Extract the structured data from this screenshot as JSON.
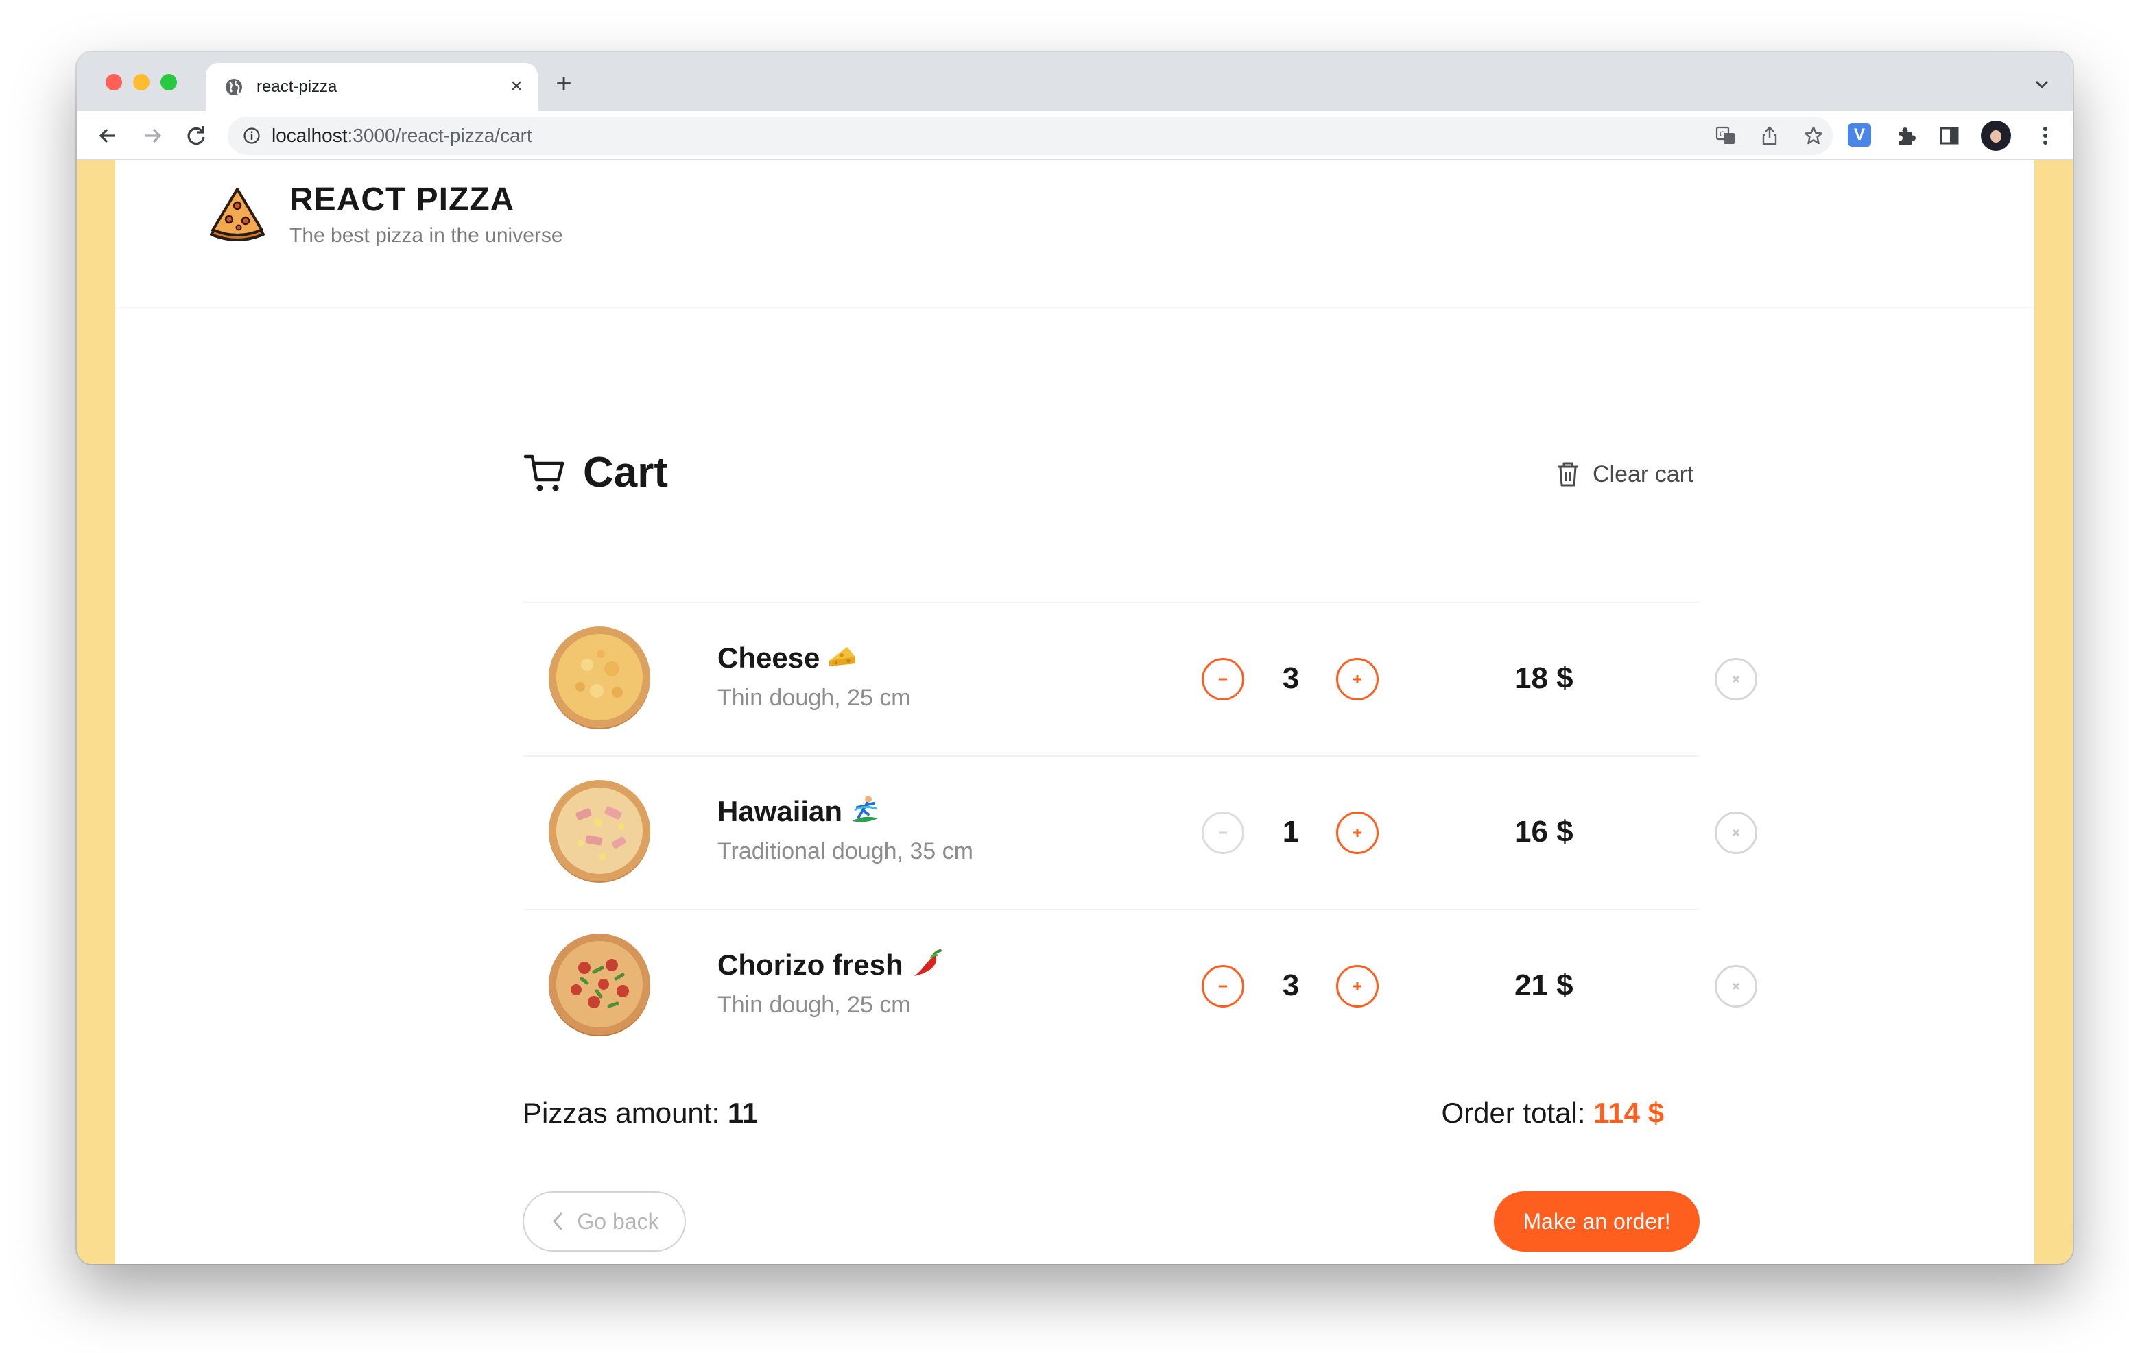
{
  "browser": {
    "tab_title": "react-pizza",
    "url_host": "localhost",
    "url_path": ":3000/react-pizza/cart"
  },
  "header": {
    "title": "REACT PIZZA",
    "subtitle": "The best pizza in the universe"
  },
  "cart": {
    "title": "Cart",
    "clear_label": "Clear cart",
    "items": [
      {
        "name": "Cheese",
        "emoji": "cheese-icon",
        "details": "Thin dough, 25 cm",
        "quantity": "3",
        "price": "18 $",
        "minus_disabled": false
      },
      {
        "name": "Hawaiian",
        "emoji": "surfer-icon",
        "details": "Traditional dough, 35 cm",
        "quantity": "1",
        "price": "16 $",
        "minus_disabled": true
      },
      {
        "name": "Chorizo fresh",
        "emoji": "hot-pepper-icon",
        "details": "Thin dough, 25 cm",
        "quantity": "3",
        "price": "21 $",
        "minus_disabled": false
      }
    ],
    "amount_label": "Pizzas amount: ",
    "amount_value": "11",
    "total_label": "Order total: ",
    "total_value": "114 $",
    "back_label": "Go back",
    "order_label": "Make an order!"
  },
  "colors": {
    "accent": "#fe5f1e",
    "page_side": "#fbdd8f",
    "disabled": "#dddddd"
  }
}
